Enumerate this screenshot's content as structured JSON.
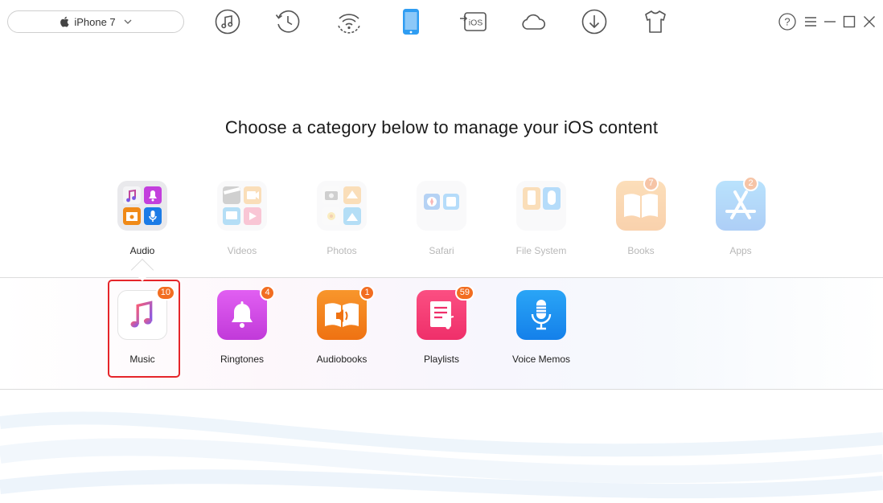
{
  "device": {
    "name": "iPhone 7",
    "icon": "apple-icon"
  },
  "toolbar": [
    {
      "name": "music-transfer",
      "icon": "music-note-icon"
    },
    {
      "name": "backup-history",
      "icon": "history-clock-icon"
    },
    {
      "name": "wifi-sync",
      "icon": "wifi-icon"
    },
    {
      "name": "device-manager",
      "icon": "phone-icon",
      "active": true
    },
    {
      "name": "ios-mover",
      "icon": "to-ios-icon",
      "text": "iOS"
    },
    {
      "name": "icloud-manager",
      "icon": "cloud-icon"
    },
    {
      "name": "downloader",
      "icon": "download-icon"
    },
    {
      "name": "ringtone-maker",
      "icon": "shirt-icon"
    }
  ],
  "window_controls": [
    "help-icon",
    "menu-icon",
    "minimize-icon",
    "maximize-icon",
    "close-icon"
  ],
  "title": "Choose a category below to manage your iOS content",
  "categories": [
    {
      "label": "Audio",
      "active": true
    },
    {
      "label": "Videos"
    },
    {
      "label": "Photos"
    },
    {
      "label": "Safari"
    },
    {
      "label": "File System"
    },
    {
      "label": "Books",
      "badge": "7"
    },
    {
      "label": "Apps",
      "badge": "2"
    }
  ],
  "subcategories": [
    {
      "label": "Music",
      "badge": "10",
      "selected": true
    },
    {
      "label": "Ringtones",
      "badge": "4"
    },
    {
      "label": "Audiobooks",
      "badge": "1"
    },
    {
      "label": "Playlists",
      "badge": "59"
    },
    {
      "label": "Voice Memos"
    }
  ],
  "colors": {
    "accent": "#1e9bf0",
    "badge": "#f26d21",
    "selection": "#e5252a"
  }
}
